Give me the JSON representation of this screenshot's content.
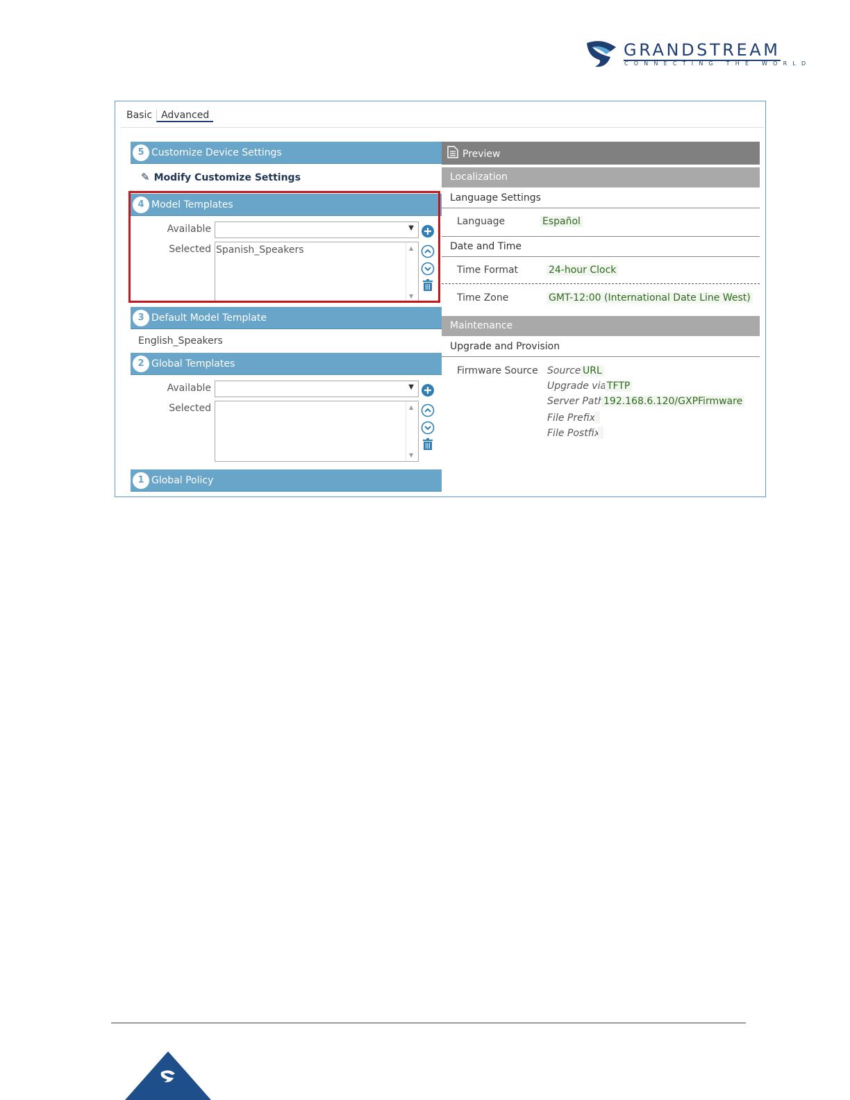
{
  "brand": {
    "name": "GRANDSTREAM",
    "tagline": "CONNECTING THE WORLD"
  },
  "tabs": [
    {
      "label": "Basic",
      "active": false
    },
    {
      "label": "Advanced",
      "active": true
    }
  ],
  "left": {
    "customize": {
      "number": "5",
      "title": "Customize Device Settings"
    },
    "modify_link": "Modify Customize Settings",
    "model_templates": {
      "number": "4",
      "title": "Model Templates",
      "available_label": "Available",
      "available_value": "",
      "selected_label": "Selected",
      "selected_items": [
        "Spanish_Speakers"
      ]
    },
    "default_model": {
      "number": "3",
      "title": "Default Model Template",
      "value": "English_Speakers"
    },
    "global_templates": {
      "number": "2",
      "title": "Global Templates",
      "available_label": "Available",
      "available_value": "",
      "selected_label": "Selected",
      "selected_items": []
    },
    "global_policy": {
      "number": "1",
      "title": "Global Policy"
    }
  },
  "preview": {
    "title": "Preview",
    "localization": {
      "title": "Localization",
      "language_settings": "Language Settings",
      "language_label": "Language",
      "language_value": "Español",
      "date_time": "Date and Time",
      "time_format_label": "Time Format",
      "time_format_value": "24-hour Clock",
      "time_zone_label": "Time Zone",
      "time_zone_value": "GMT-12:00 (International Date Line West)"
    },
    "maintenance": {
      "title": "Maintenance",
      "upgrade": "Upgrade and Provision",
      "firmware_label": "Firmware Source",
      "source_label": "Source",
      "source_value": "URL",
      "upgrade_via_label": "Upgrade via",
      "upgrade_via_value": "TFTP",
      "server_path_label": "Server Path",
      "server_path_value": "192.168.6.120/GXPFirmware",
      "file_prefix_label": "File Prefix",
      "file_prefix_value": "",
      "file_postfix_label": "File Postfix",
      "file_postfix_value": ""
    }
  },
  "colors": {
    "section_bar": "#69a5c9",
    "highlight_border": "#c8151b",
    "preview_header": "#808080",
    "value_green": "#2e6b1d",
    "brand_navy": "#1f3f73"
  }
}
